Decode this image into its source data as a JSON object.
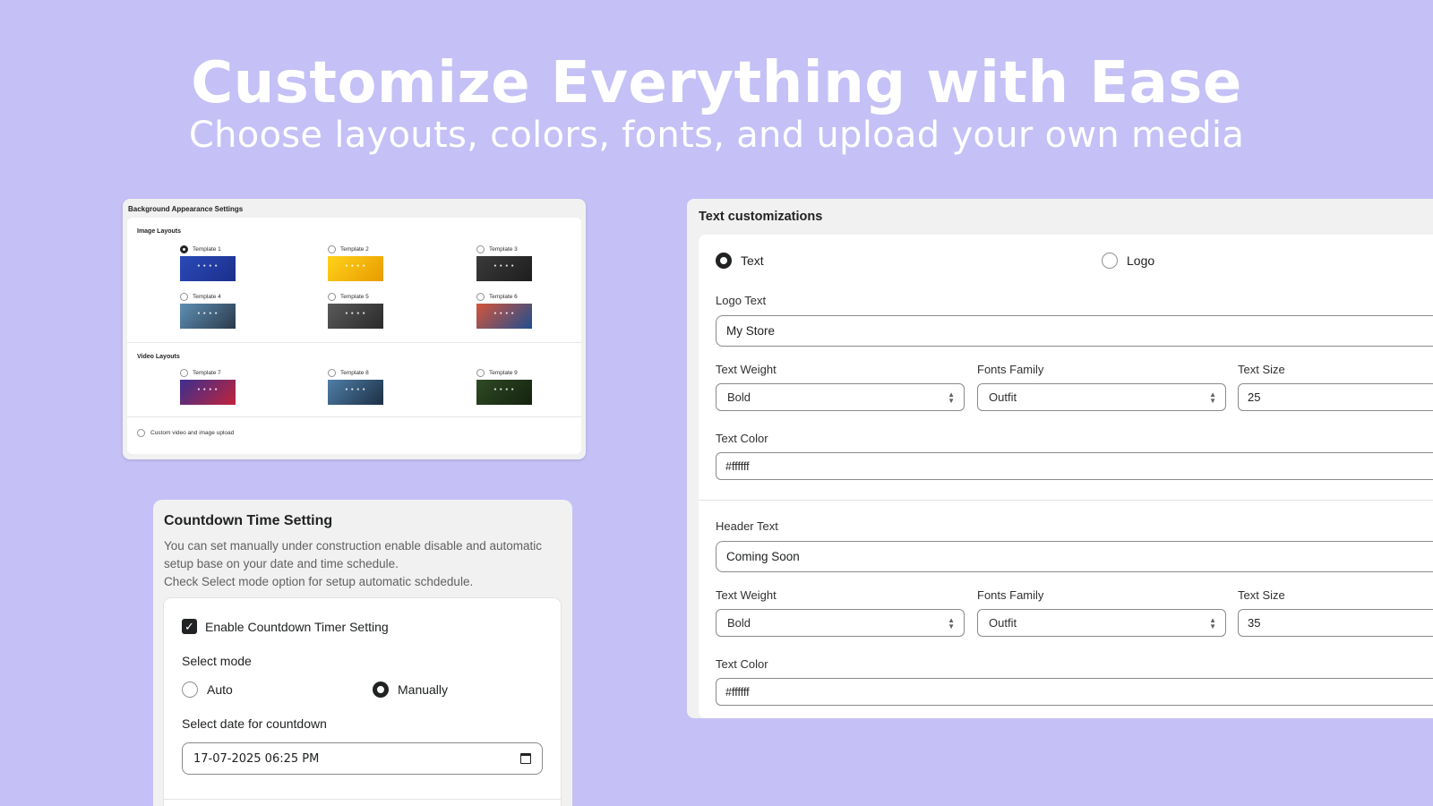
{
  "hero": {
    "title": "Customize Everything with Ease",
    "subtitle": "Choose layouts, colors, fonts, and upload your own media"
  },
  "background_settings": {
    "title": "Background Appearance Settings",
    "image_layouts_label": "Image Layouts",
    "video_layouts_label": "Video Layouts",
    "templates": [
      {
        "label": "Template 1",
        "selected": true,
        "thumb_colors": [
          "#2a4ab8",
          "#1c2f8a"
        ]
      },
      {
        "label": "Template 2",
        "selected": false,
        "thumb_colors": [
          "#ffd21a",
          "#e89b00"
        ]
      },
      {
        "label": "Template 3",
        "selected": false,
        "thumb_colors": [
          "#3a3a3a",
          "#1e1e1e"
        ]
      },
      {
        "label": "Template 4",
        "selected": false,
        "thumb_colors": [
          "#5e8fb4",
          "#2a3a4a"
        ]
      },
      {
        "label": "Template 5",
        "selected": false,
        "thumb_colors": [
          "#5a5a5a",
          "#2a2a2a"
        ]
      },
      {
        "label": "Template 6",
        "selected": false,
        "thumb_colors": [
          "#d4553a",
          "#1f4f8f"
        ]
      },
      {
        "label": "Template 7",
        "selected": false,
        "thumb_colors": [
          "#3b2f8f",
          "#c0233a"
        ]
      },
      {
        "label": "Template 8",
        "selected": false,
        "thumb_colors": [
          "#4f7fa8",
          "#1d2f44"
        ]
      },
      {
        "label": "Template 9",
        "selected": false,
        "thumb_colors": [
          "#2f4a24",
          "#14220f"
        ]
      }
    ],
    "custom_upload_label": "Custom video and image upload"
  },
  "countdown": {
    "title": "Countdown Time Setting",
    "description_line1": "You can set manually under construction enable disable and automatic setup base on your date and time schedule.",
    "description_line2": "Check Select mode option for setup automatic schdedule.",
    "enable_label": "Enable Countdown Timer Setting",
    "enable_checked": true,
    "select_mode_label": "Select mode",
    "mode_auto": "Auto",
    "mode_manual": "Manually",
    "selected_mode": "Manually",
    "date_label": "Select date for countdown",
    "date_value": "17-07-2025  06:25 PM"
  },
  "text_custom": {
    "title": "Text customizations",
    "option_text": "Text",
    "option_logo": "Logo",
    "selected_option": "Text",
    "logo": {
      "label": "Logo Text",
      "value": "My Store",
      "weight_label": "Text Weight",
      "weight_value": "Bold",
      "family_label": "Fonts Family",
      "family_value": "Outfit",
      "size_label": "Text Size",
      "size_value": "25",
      "color_label": "Text Color",
      "color_value": "#ffffff"
    },
    "header": {
      "label": "Header Text",
      "value": "Coming Soon",
      "weight_label": "Text Weight",
      "weight_value": "Bold",
      "family_label": "Fonts Family",
      "family_value": "Outfit",
      "size_label": "Text Size",
      "size_value": "35",
      "color_label": "Text Color",
      "color_value": "#ffffff"
    }
  }
}
